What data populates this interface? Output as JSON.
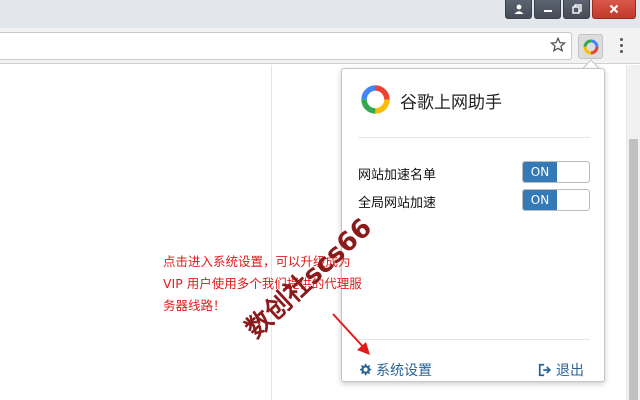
{
  "popup": {
    "title": "谷歌上网助手",
    "settings": [
      {
        "label": "网站加速名单",
        "toggle": "ON"
      },
      {
        "label": "全局网站加速",
        "toggle": "ON"
      }
    ],
    "footer": {
      "settings_label": "系统设置",
      "logout_label": "退出"
    }
  },
  "annotation": {
    "lines": [
      "点击进入系统设置，可以升级成为",
      "VIP 用户使用多个我们提供的代理服",
      "务器线路！"
    ]
  },
  "watermark": "数创社scs66",
  "colors": {
    "accent": "#337ab7",
    "link": "#2a6496",
    "annotation": "#e01b1b",
    "close_button": "#c1392b"
  },
  "icons": {
    "window_controls": [
      "profile-icon",
      "minimize-icon",
      "maximize-icon",
      "close-icon"
    ],
    "toolbar": [
      "bookmark-star-icon",
      "extension-icon",
      "menu-icon"
    ],
    "footer": [
      "gear-icon",
      "sign-out-icon"
    ]
  }
}
